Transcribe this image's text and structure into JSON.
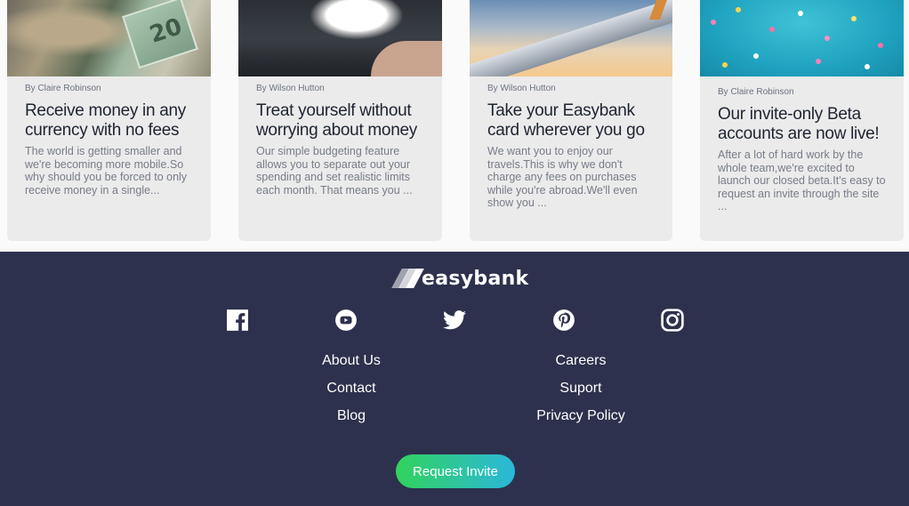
{
  "articles": [
    {
      "author": "By Claire Robinson",
      "title": "Receive money in any currency with no fees",
      "excerpt": "The world is getting smaller and we're becoming more mobile.So why should you be forced to only receive money in a single..."
    },
    {
      "author": "By Wilson Hutton",
      "title": "Treat yourself without worrying about money",
      "excerpt": "Our simple budgeting feature allows you to separate out your spending and set realistic limits each month. That means you ..."
    },
    {
      "author": "By Wilson Hutton",
      "title": "Take your Easybank card wherever you go",
      "excerpt": "We want you to enjoy our travels.This is why we don't charge any fees on purchases while you're abroad.We'll even show you ..."
    },
    {
      "author": "By Claire Robinson",
      "title": "Our invite-only Beta accounts are now live!",
      "excerpt": "After a lot of hard work by the whole team,we're excited to launch our closed beta.It's easy to request an invite through the site ..."
    }
  ],
  "footer": {
    "logo_text": "easybank",
    "socials": [
      "facebook-icon",
      "youtube-icon",
      "twitter-icon",
      "pinterest-icon",
      "instagram-icon"
    ],
    "links_left": [
      "About Us",
      "Contact",
      "Blog"
    ],
    "links_right": [
      "Careers",
      "Suport",
      "Privacy Policy"
    ],
    "cta_label": "Request Invite"
  },
  "colors": {
    "footer_bg": "#2d314d",
    "card_bg": "#ebebeb",
    "cta_gradient_start": "#31d35c",
    "cta_gradient_end": "#2bb7da"
  }
}
